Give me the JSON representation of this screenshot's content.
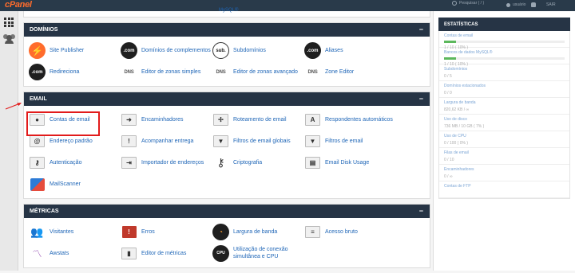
{
  "header": {
    "logo": "cPanel",
    "search_placeholder": "Pesquisar ( / )",
    "user_label": "usuário",
    "logout_label": "SAIR"
  },
  "prev_section": {
    "visible_item": "MySQL®"
  },
  "sections": [
    {
      "title": "DOMÍNIOS",
      "items": [
        {
          "label": "Site Publisher",
          "icon": "rocket-icon"
        },
        {
          "label": "Domínios de complementos",
          "icon": "com-add-icon"
        },
        {
          "label": "Subdomínios",
          "icon": "sub-icon"
        },
        {
          "label": "Aliases",
          "icon": "com-alias-icon"
        },
        {
          "label": "Redireciona",
          "icon": "com-redirect-icon"
        },
        {
          "label": "Editor de zonas simples",
          "icon": "dns-simple-icon"
        },
        {
          "label": "Editor de zonas avançado",
          "icon": "dns-advanced-icon"
        },
        {
          "label": "Zone Editor",
          "icon": "dns-zone-icon"
        }
      ]
    },
    {
      "title": "EMAIL",
      "items": [
        {
          "label": "Contas de email",
          "icon": "email-accounts-icon"
        },
        {
          "label": "Encaminhadores",
          "icon": "forwarders-icon"
        },
        {
          "label": "Roteamento de email",
          "icon": "email-routing-icon"
        },
        {
          "label": "Respondentes automáticos",
          "icon": "autoresponder-icon"
        },
        {
          "label": "Endereço padrão",
          "icon": "default-address-icon"
        },
        {
          "label": "Acompanhar entrega",
          "icon": "track-delivery-icon"
        },
        {
          "label": "Filtros de email globais",
          "icon": "global-filters-icon"
        },
        {
          "label": "Filtros de email",
          "icon": "email-filters-icon"
        },
        {
          "label": "Autenticação",
          "icon": "authentication-icon"
        },
        {
          "label": "Importador de endereços",
          "icon": "address-importer-icon"
        },
        {
          "label": "Criptografia",
          "icon": "encryption-key-icon"
        },
        {
          "label": "Email Disk Usage",
          "icon": "email-disk-usage-icon"
        },
        {
          "label": "MailScanner",
          "icon": "mailscanner-icon"
        }
      ]
    },
    {
      "title": "MÉTRICAS",
      "items": [
        {
          "label": "Visitantes",
          "icon": "visitors-icon"
        },
        {
          "label": "Erros",
          "icon": "errors-icon"
        },
        {
          "label": "Largura de banda",
          "icon": "bandwidth-icon"
        },
        {
          "label": "Acesso bruto",
          "icon": "raw-access-icon"
        },
        {
          "label": "Awstats",
          "icon": "awstats-icon"
        },
        {
          "label": "Editor de métricas",
          "icon": "metrics-editor-icon"
        },
        {
          "label": "Utilização de conexão simultânea e CPU",
          "icon": "cpu-icon"
        }
      ]
    }
  ],
  "stats": {
    "title": "ESTATÍSTICAS",
    "rows": [
      {
        "label": "Contas de email",
        "value": "1 / 10 ( 10% )",
        "fill": 0.1
      },
      {
        "label": "Bancos de dados MySQL®",
        "value": "1 / 10 ( 10% )",
        "fill": 0.1
      },
      {
        "label": "Subdomínios",
        "value": "0 / 5"
      },
      {
        "label": "Domínios estacionados",
        "value": "0 / 0"
      },
      {
        "label": "Largura de banda",
        "value": "820,62 KB / ∞"
      },
      {
        "label": "Uso de disco",
        "value": "736 MB / 10 GB ( 7% )"
      },
      {
        "label": "Uso de CPU",
        "value": "0 / 100 ( 0% )"
      },
      {
        "label": "Filas de email",
        "value": "0 / 10"
      },
      {
        "label": "Encaminhadores",
        "value": "0 / ∞"
      },
      {
        "label": "Contas de FTP",
        "value": ""
      }
    ]
  }
}
